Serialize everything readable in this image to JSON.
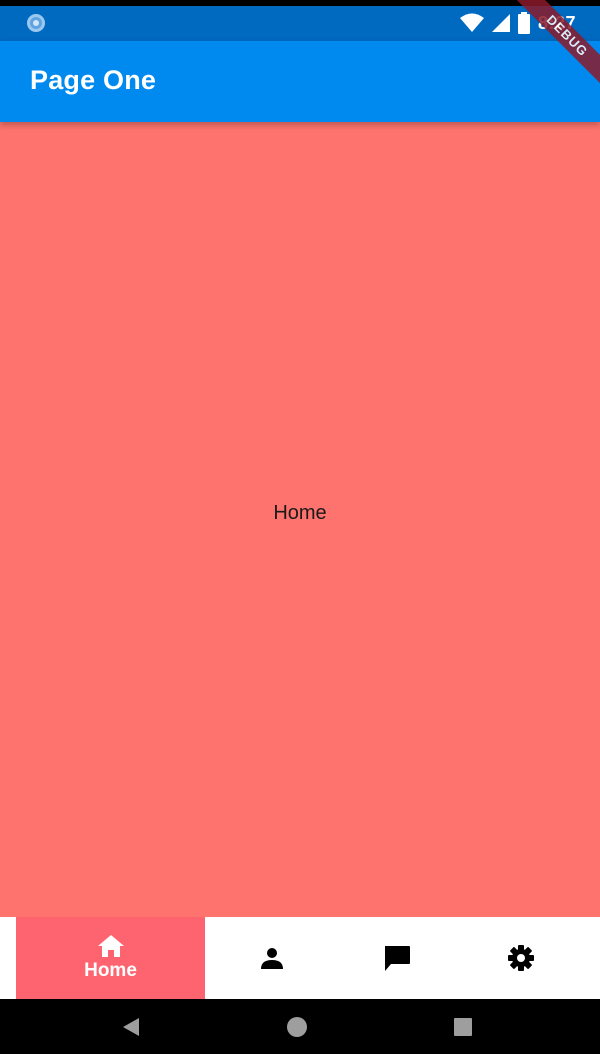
{
  "status_bar": {
    "time": "8:27",
    "icons": [
      "app-notification-icon",
      "wifi-icon",
      "cell-signal-icon",
      "battery-icon"
    ]
  },
  "debug_banner": "DEBUG",
  "app_bar": {
    "title": "Page One"
  },
  "content": {
    "label": "Home",
    "background": "#fe736d"
  },
  "bottom_nav": {
    "selected_index": 0,
    "selected_color": "#fd6470",
    "items": [
      {
        "icon": "home-icon",
        "label": "Home"
      },
      {
        "icon": "person-icon",
        "label": ""
      },
      {
        "icon": "chat-icon",
        "label": ""
      },
      {
        "icon": "gear-icon",
        "label": ""
      }
    ]
  },
  "system_nav": {
    "buttons": [
      "back-icon",
      "home-circle-icon",
      "recents-icon"
    ]
  },
  "colors": {
    "status_bar": "#0069c0",
    "app_bar": "#008aef",
    "accent": "#fd6470"
  }
}
